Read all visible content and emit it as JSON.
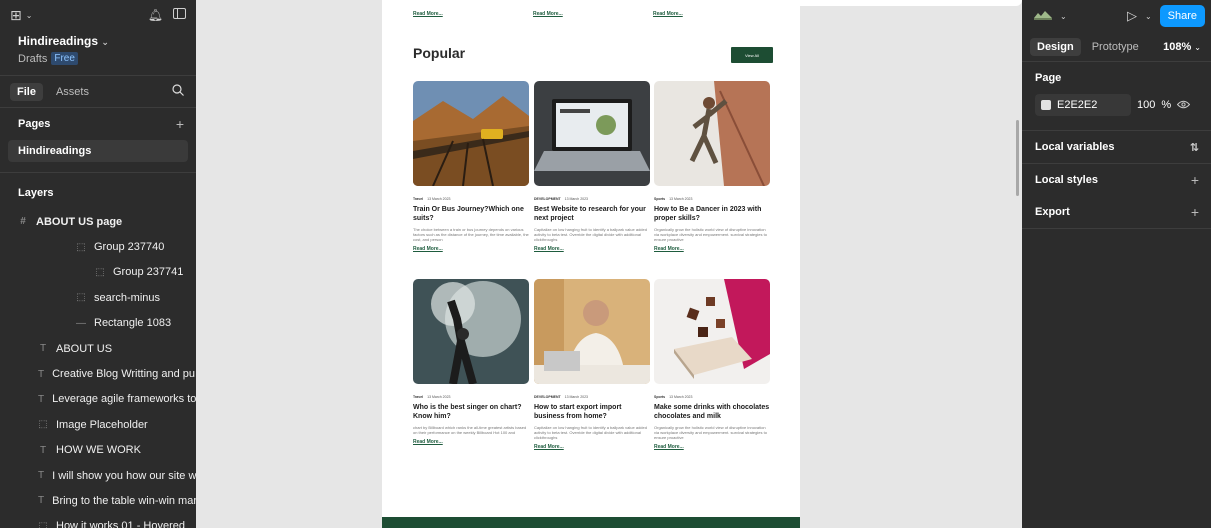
{
  "left_panel": {
    "project_name": "Hindireadings",
    "drafts_label": "Drafts",
    "plan_badge": "Free",
    "tabs": [
      "File",
      "Assets"
    ],
    "pages_heading": "Pages",
    "pages": [
      "Hindireadings"
    ],
    "layers_heading": "Layers",
    "layers": [
      {
        "label": "ABOUT US page",
        "icon": "frame-icon",
        "indent": 0
      },
      {
        "label": "Group 237740",
        "icon": "group-icon",
        "indent": 2
      },
      {
        "label": "Group 237741",
        "icon": "group-icon",
        "indent": 3
      },
      {
        "label": "search-minus",
        "icon": "group-icon",
        "indent": 2
      },
      {
        "label": "Rectangle 1083",
        "icon": "rectangle-icon",
        "indent": 2
      },
      {
        "label": "ABOUT US",
        "icon": "text-icon",
        "indent": 1
      },
      {
        "label": "Creative Blog Writting and pu...",
        "icon": "text-icon",
        "indent": 1
      },
      {
        "label": "Leverage agile frameworks to ...",
        "icon": "text-icon",
        "indent": 1
      },
      {
        "label": "Image Placeholder",
        "icon": "image-icon",
        "indent": 1
      },
      {
        "label": "HOW WE WORK",
        "icon": "text-icon",
        "indent": 1
      },
      {
        "label": "I will show you how our site w...",
        "icon": "text-icon",
        "indent": 1
      },
      {
        "label": "Bring to the table win-win mar...",
        "icon": "text-icon",
        "indent": 1
      },
      {
        "label": "How it works 01 - Hovered",
        "icon": "group-icon",
        "indent": 1
      }
    ]
  },
  "canvas": {
    "top_read_more": [
      "Read More...",
      "Read More...",
      "Read More..."
    ],
    "section_title": "Popular",
    "view_all": "View All",
    "cards": [
      {
        "category": "Travel",
        "date": "13 March 2023",
        "title": "Train Or Bus Journey?Which one suits?",
        "desc": "The choice between a train or bus journey depends on various factors such as the distance of the journey, the time available, the cost, and person",
        "read_more": "Read More...",
        "image": "train-photo"
      },
      {
        "category": "DEVELOPMENT",
        "date": "13 March 2023",
        "title": "Best Website to research for your next project",
        "desc": "Capitalize on low hanging fruit to identify a ballpark value added activity to beta test. Override the digital divide with additional clickthroughs",
        "read_more": "Read More...",
        "image": "laptop-photo"
      },
      {
        "category": "Sports",
        "date": "13 March 2023",
        "title": "How to Be a Dancer in 2023 with proper skills?",
        "desc": "Organically grow the holistic world view of disruptive innovation via workplace diversity and empowerment. survival strategies to ensure proactive",
        "read_more": "Read More...",
        "image": "dancer-photo"
      },
      {
        "category": "Travel",
        "date": "13 March 2023",
        "title": "Who is the best singer on chart? Know him?",
        "desc": "chart by Billboard which ranks the all-time greatest artists based on their performance on the weekly Billboard Hot 100 and",
        "read_more": "Read More...",
        "image": "singer-photo"
      },
      {
        "category": "DEVELOPMENT",
        "date": "13 March 2023",
        "title": "How to start export import business from home?",
        "desc": "Capitalize on low hanging fruit to identify a ballpark value added activity to beta test. Override the digital divide with additional clickthroughs",
        "read_more": "Read More...",
        "image": "businessman-photo"
      },
      {
        "category": "Sports",
        "date": "13 March 2023",
        "title": "Make some drinks with chocolates chocolates and milk",
        "desc": "Organically grow the holistic world view of disruptive innovation via workplace diversity and empowerment. survival strategies to ensure proactive",
        "read_more": "Read More...",
        "image": "chocolate-photo"
      }
    ]
  },
  "right_panel": {
    "share_label": "Share",
    "tabs": [
      "Design",
      "Prototype"
    ],
    "zoom": "108%",
    "page_heading": "Page",
    "page_fill_hex": "E2E2E2",
    "page_fill_opacity": "100",
    "percent_sign": "%",
    "local_variables": "Local variables",
    "local_styles": "Local styles",
    "export": "Export",
    "colors": {
      "accent": "#0d99ff",
      "page_fill": "#e2e2e2"
    }
  }
}
